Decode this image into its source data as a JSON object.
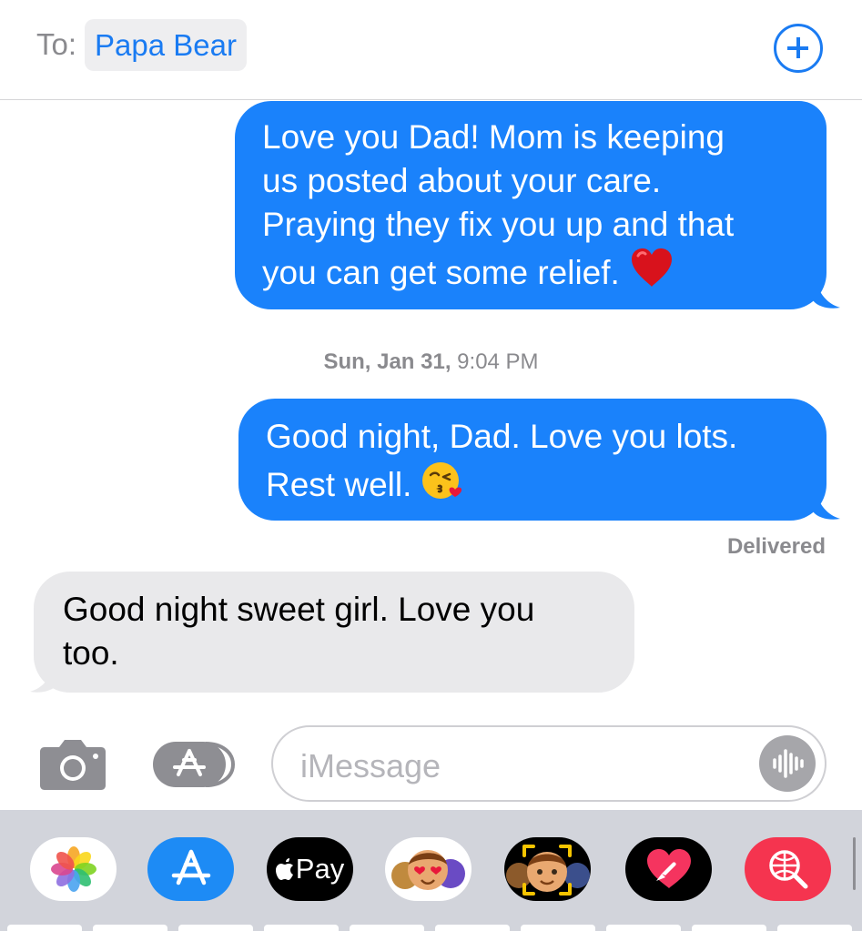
{
  "header": {
    "to_label": "To:",
    "recipient": "Papa Bear",
    "add_icon": "plus-circle-icon"
  },
  "messages": [
    {
      "direction": "outgoing",
      "text": "Love you Dad! Mom is keeping us posted about your care. Praying they fix you up and that you can get some relief.",
      "lines": [
        "Love you Dad! Mom is keeping",
        "us posted about your care.",
        "Praying they fix you up and that",
        "you can get some relief."
      ],
      "emoji": "red-heart-emoji"
    },
    {
      "direction": "outgoing",
      "lines": [
        "Good night, Dad. Love you lots.",
        "Rest well."
      ],
      "emoji": "face-blowing-kiss-emoji"
    },
    {
      "direction": "incoming",
      "lines": [
        "Good night sweet girl.  Love you",
        "too."
      ]
    }
  ],
  "timestamp": {
    "day": "Sun, Jan 31,",
    "time": "9:04 PM"
  },
  "status": "Delivered",
  "input": {
    "placeholder": "iMessage",
    "camera_icon": "camera-icon",
    "apps_icon": "app-store-icon",
    "audio_icon": "waveform-icon"
  },
  "drawer_apps": [
    {
      "name": "photos-app",
      "icon": "photos-flower-icon"
    },
    {
      "name": "app-store-app",
      "icon": "app-store-icon",
      "color": "#1d8bf5"
    },
    {
      "name": "apple-pay-app",
      "label": "Pay",
      "color": "#000000"
    },
    {
      "name": "memoji-stickers-app",
      "icon": "memoji-stickers-icon"
    },
    {
      "name": "animoji-app",
      "icon": "animoji-icon",
      "color": "#000000"
    },
    {
      "name": "digital-touch-app",
      "icon": "digital-touch-heart-icon",
      "color": "#000000"
    },
    {
      "name": "images-search-app",
      "icon": "globe-search-icon",
      "color": "#f5344f"
    }
  ],
  "colors": {
    "outgoing_bubble": "#1a82fb",
    "incoming_bubble": "#e9e9eb",
    "accent": "#1a7bf2",
    "drawer_bg": "#d2d4db"
  }
}
